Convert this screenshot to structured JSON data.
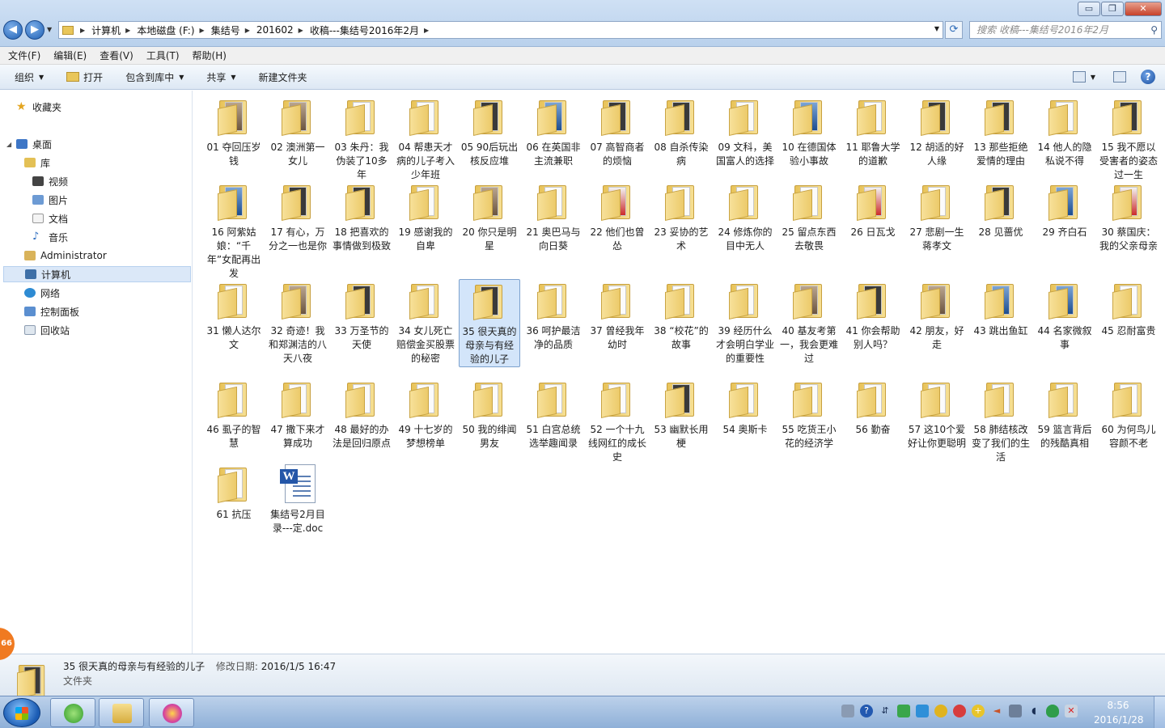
{
  "window": {
    "controls": {
      "minimize": "▭",
      "maximize": "❐",
      "close": "✕"
    }
  },
  "address": {
    "segments": [
      "计算机",
      "本地磁盘 (F:)",
      "集结号",
      "201602",
      "收稿---集结号2016年2月"
    ]
  },
  "search": {
    "placeholder": "搜索 收稿---集结号2016年2月"
  },
  "menu": [
    "文件(F)",
    "编辑(E)",
    "查看(V)",
    "工具(T)",
    "帮助(H)"
  ],
  "toolbar": {
    "organize": "组织",
    "open": "打开",
    "include": "包含到库中",
    "share": "共享",
    "new_folder": "新建文件夹"
  },
  "nav": {
    "favorites": "收藏夹",
    "desktop": "桌面",
    "libraries": "库",
    "video": "视频",
    "pictures": "图片",
    "documents": "文档",
    "music": "音乐",
    "user": "Administrator",
    "computer": "计算机",
    "network": "网络",
    "control_panel": "控制面板",
    "recycle_bin": "回收站"
  },
  "items": [
    {
      "name": "01 夺回压岁钱",
      "style": "photo"
    },
    {
      "name": "02 澳洲第一女儿",
      "style": "photo"
    },
    {
      "name": "03 朱丹：我伪装了10多年",
      "style": "plain"
    },
    {
      "name": "04 帮患天才病的儿子考入少年班",
      "style": "plain"
    },
    {
      "name": "05 90后玩出核反应堆",
      "style": "dark"
    },
    {
      "name": "06 在英国非主流兼职",
      "style": "blue"
    },
    {
      "name": "07 高智商者的烦恼",
      "style": "dark"
    },
    {
      "name": "08 自杀传染病",
      "style": "dark"
    },
    {
      "name": "09 文科，美国富人的选择",
      "style": "plain"
    },
    {
      "name": "10 在德国体验小事故",
      "style": "blue"
    },
    {
      "name": "11 耶鲁大学的道歉",
      "style": "plain"
    },
    {
      "name": "12 胡适的好人缘",
      "style": "dark"
    },
    {
      "name": "13 那些拒绝爱情的理由",
      "style": "dark"
    },
    {
      "name": "14 他人的隐私说不得",
      "style": "plain"
    },
    {
      "name": "15 我不愿以受害者的姿态过一生",
      "style": "dark"
    },
    {
      "name": "16 阿紫姑娘：“千年”女配再出发",
      "style": "blue"
    },
    {
      "name": "17 有心，万分之一也是你",
      "style": "dark"
    },
    {
      "name": "18 把喜欢的事情做到极致",
      "style": "dark"
    },
    {
      "name": "19 感谢我的自卑",
      "style": "plain"
    },
    {
      "name": "20 你只是明星",
      "style": "photo"
    },
    {
      "name": "21 奥巴马与向日葵",
      "style": "plain"
    },
    {
      "name": "22 他们也曾怂",
      "style": "red"
    },
    {
      "name": "23 妥协的艺术",
      "style": "plain"
    },
    {
      "name": "24 修炼你的目中无人",
      "style": "plain"
    },
    {
      "name": "25 留点东西去敬畏",
      "style": "plain"
    },
    {
      "name": "26 日瓦戈",
      "style": "red"
    },
    {
      "name": "27 悲剧一生蒋孝文",
      "style": "plain"
    },
    {
      "name": "28 见蔷优",
      "style": "dark"
    },
    {
      "name": "29 齐白石",
      "style": "blue"
    },
    {
      "name": "30 蔡国庆：我的父亲母亲",
      "style": "red"
    },
    {
      "name": "31 懒人达尔文",
      "style": "plain"
    },
    {
      "name": "32 奇迹！我和郑渊洁的八天八夜",
      "style": "photo"
    },
    {
      "name": "33 万圣节的天使",
      "style": "dark"
    },
    {
      "name": "34 女儿死亡赔偿金买股票的秘密",
      "style": "plain"
    },
    {
      "name": "35 很天真的母亲与有经验的儿子",
      "style": "dark"
    },
    {
      "name": "36 呵护最洁净的品质",
      "style": "plain"
    },
    {
      "name": "37 曾经我年幼时",
      "style": "plain"
    },
    {
      "name": "38 “校花”的故事",
      "style": "plain"
    },
    {
      "name": "39 经历什么才会明白学业的重要性",
      "style": "plain"
    },
    {
      "name": "40 基友考第一，我会更难过",
      "style": "photo"
    },
    {
      "name": "41 你会帮助别人吗？",
      "style": "dark"
    },
    {
      "name": "42 朋友，好走",
      "style": "photo"
    },
    {
      "name": "43 跳出鱼缸",
      "style": "blue"
    },
    {
      "name": "44 名家微叙事",
      "style": "blue"
    },
    {
      "name": "45 忍耐富贵",
      "style": "plain"
    },
    {
      "name": "46 虱子的智慧",
      "style": "plain"
    },
    {
      "name": "47 撒下来才算成功",
      "style": "plain"
    },
    {
      "name": "48 最好的办法是回归原点",
      "style": "plain"
    },
    {
      "name": "49 十七岁的梦想榜单",
      "style": "plain"
    },
    {
      "name": "50 我的绯闻男友",
      "style": "plain"
    },
    {
      "name": "51 白宫总统选举趣闻录",
      "style": "plain"
    },
    {
      "name": "52 一个十九线网红的成长史",
      "style": "plain"
    },
    {
      "name": "53 幽默长用梗",
      "style": "dark"
    },
    {
      "name": "54 奥斯卡",
      "style": "plain"
    },
    {
      "name": "55 吃货王小花的经济学",
      "style": "plain"
    },
    {
      "name": "56 勤奋",
      "style": "plain"
    },
    {
      "name": "57 这10个爱好让你更聪明",
      "style": "plain"
    },
    {
      "name": "58 肺结核改变了我们的生活",
      "style": "plain"
    },
    {
      "name": "59 篮言背后的残酷真相",
      "style": "plain"
    },
    {
      "name": "60 为何鸟儿容颜不老",
      "style": "plain"
    },
    {
      "name": "61 抗压",
      "style": "plain"
    },
    {
      "name": "集结号2月目录---定.doc",
      "style": "doc"
    }
  ],
  "selected_index": 34,
  "details": {
    "name": "35 很天真的母亲与有经验的儿子",
    "date_label": "修改日期:",
    "date": "2016/1/5 16:47",
    "type": "文件夹"
  },
  "badge": "66",
  "taskbar": {
    "time": "8:56",
    "date": "2016/1/28"
  }
}
